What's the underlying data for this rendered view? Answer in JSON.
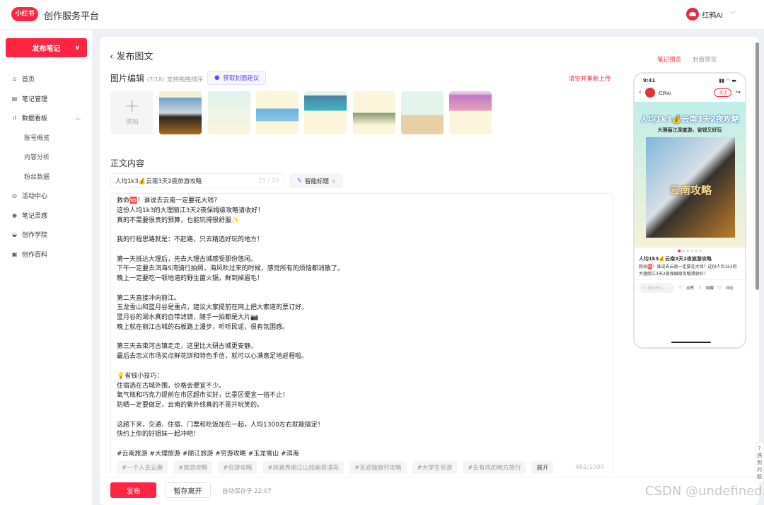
{
  "header": {
    "logo": "小红书",
    "title": "创作服务平台",
    "user": "红鸦AI"
  },
  "sidebar": {
    "publish_label": "发布笔记",
    "items": [
      {
        "label": "首页",
        "icon": "home-icon"
      },
      {
        "label": "笔记管理",
        "icon": "note-icon"
      },
      {
        "label": "数据看板",
        "icon": "chart-icon"
      },
      {
        "label": "账号概览",
        "sub": true
      },
      {
        "label": "内容分析",
        "sub": true
      },
      {
        "label": "粉丝数据",
        "sub": true
      },
      {
        "label": "活动中心",
        "icon": "target-icon"
      },
      {
        "label": "笔记灵感",
        "icon": "bulb-search-icon"
      },
      {
        "label": "创作学院",
        "icon": "academy-icon"
      },
      {
        "label": "创作百科",
        "icon": "book-icon"
      }
    ]
  },
  "editor": {
    "page_title": "发布图文",
    "image_section": {
      "title": "图片编辑",
      "count": "(7/18)",
      "hint": "支持拖拽排序",
      "cover_btn": "获取封面建议",
      "clear_btn": "清空并重新上传",
      "add_label": "添加"
    },
    "body_section": {
      "title": "正文内容"
    },
    "title_input": {
      "value": "人均1k3💰云南3天2夜旅游攻略",
      "count": "15 / 20"
    },
    "smart_title": "智能标题",
    "body": "救命🆘！谁说去云南一定要花大钱？\n这份人均1k3的大理丽江3天2夜保姆级攻略请收好！\n真的不需要很贵的预算，也能玩得很舒服✨\n\n我的行程思路就是：不赶路，只去精选好玩的地方！\n\n第一天抵达大理后，先去大理古城感受那份悠闲。\n下午一定要去洱海S湾骑行拍照，海风吹过来的时候，感觉所有的烦恼都消散了。\n晚上一定要吃一顿地道的野生菌火锅，鲜到掉眉毛！\n\n第二天直接冲向丽江。\n玉龙雪山和蓝月谷是重点，建议大家提前在网上把大索道的票订好。\n蓝月谷的湖水真的自带滤镜，随手一拍都是大片📷\n晚上就在丽江古城的石板路上漫步，听听民谣，很有氛围感。\n\n第三天去束河古镇走走，这里比大研古城更安静。\n最后去忠义市场买点鲜花饼和特色手信，就可以心满意足地返程啦。\n\n💡省钱小技巧：\n住宿选在古城外围，价格会便宜不少。\n氧气瓶和巧克力提前在市区超市买好，比景区便宜一倍不止！\n防晒一定要做足，云南的紫外线真的不是开玩笑的。\n\n这趟下来，交通、住宿、门票和吃饭加在一起，人均1300左右就能搞定！\n快约上你的好姐妹一起冲吧！\n\n#云南旅游 #大理旅游 #丽江旅游 #穷游攻略 #玉龙雪山 #洱海",
    "tags": [
      "#一个人去云南",
      "#旅游攻略",
      "#穷游攻略",
      "#风景秀丽江山如画很漂亮",
      "#无滤镜旅行攻略",
      "#大学生穷游",
      "#去有风的地方旅行"
    ],
    "expand": "展开",
    "char_count": "462/1000"
  },
  "footer": {
    "publish": "发布",
    "save": "暂存离开",
    "autosave": "自动保存于 22:07"
  },
  "preview": {
    "tabs": [
      "笔记预览",
      "封面预览"
    ],
    "time": "9:41",
    "author": "红鸦AI",
    "follow": "关注",
    "cover_title": "人均1k3💰云南3天2夜攻略",
    "cover_subtitle": "大理丽江深度游，省钱又好玩",
    "cover_overlay": "云南攻略",
    "note_title": "人均1k3💰云南3天2夜旅游攻略",
    "note_text": "救命🆘！谁说去云南一定要花大钱？这份人均1k3的大理丽江3天2夜保姆级攻略请收好！",
    "comment_placeholder": "说点什么...",
    "like": "点赞",
    "collect": "收藏",
    "comment": "评论"
  },
  "help": "遇到问题",
  "watermark": "CSDN @undefined",
  "colors": {
    "brand": "#ff2442",
    "accent_purple": "#5b4bff"
  }
}
